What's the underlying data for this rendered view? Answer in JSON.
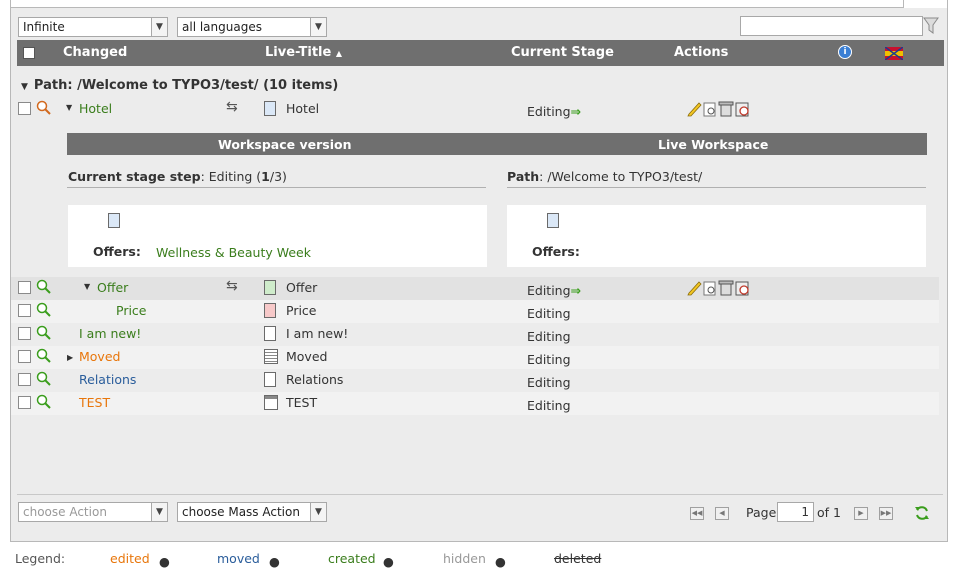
{
  "toolbar": {
    "depth_select": "Infinite",
    "language_select": "all languages",
    "search_value": ""
  },
  "columns": {
    "changed": "Changed",
    "live_title": "Live-Title",
    "current_stage": "Current Stage",
    "actions": "Actions"
  },
  "path_group": {
    "label": "Path: /Welcome to TYPO3/test/ (10 items)"
  },
  "rows": [
    {
      "changed": "Hotel",
      "live_title": "Hotel",
      "stage": "Editing",
      "arrow": "⇒"
    },
    {
      "changed": "Offer",
      "live_title": "Offer",
      "stage": "Editing",
      "arrow": "⇒"
    },
    {
      "changed": "Price",
      "live_title": "Price",
      "stage": "Editing"
    },
    {
      "changed": "I am new!",
      "live_title": "I am new!",
      "stage": "Editing"
    },
    {
      "changed": "Moved",
      "live_title": "Moved",
      "stage": "Editing"
    },
    {
      "changed": "Relations",
      "live_title": "Relations",
      "stage": "Editing"
    },
    {
      "changed": "TEST",
      "live_title": "TEST",
      "stage": "Editing"
    }
  ],
  "detail": {
    "workspace_header": "Workspace version",
    "live_header": "Live Workspace",
    "stage_label": "Current stage step",
    "stage_value": "Editing",
    "stage_step": "1",
    "stage_total": "/3)",
    "path_label": "Path",
    "path_value": "/Welcome to TYPO3/test/",
    "offers_label": "Offers:",
    "offers_workspace_value": "Wellness & Beauty Week",
    "offers_live_label": "Offers:"
  },
  "footer": {
    "action_select": "choose Action",
    "mass_action_select": "choose Mass Action",
    "page_label": "Page",
    "page_value": "1",
    "page_of": "of 1"
  },
  "legend": {
    "title": "Legend:",
    "edited": "edited",
    "moved": "moved",
    "created": "created",
    "hidden": "hidden",
    "deleted": "deleted"
  },
  "colors": {
    "created": "#3a7d1c",
    "edited": "#e8760b",
    "moved": "#2a5d9b",
    "header_bg": "#6f6f6f"
  }
}
